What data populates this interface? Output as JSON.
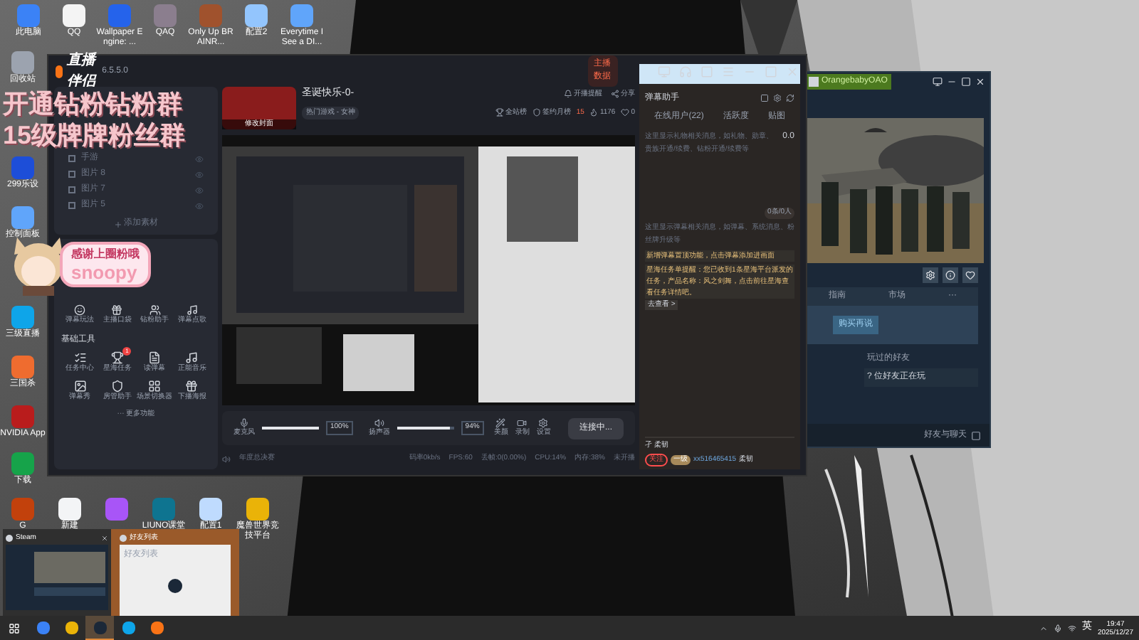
{
  "desktop": {
    "top_icons": [
      "此电脑",
      "QQ",
      "Wallpaper Engine: ...",
      "QAQ",
      "Only Up BRAINR...",
      "配置2",
      "Everytime I See a DI..."
    ],
    "left_icons": [
      "回收站",
      "299乐设",
      "控制面板",
      "三级直播",
      "三国杀",
      "NVIDIA App",
      "下载"
    ],
    "bottom_icons": [
      {
        "kind": "labeled",
        "label": "G"
      },
      {
        "kind": "labeled",
        "label": "新建"
      },
      {
        "kind": "plain"
      },
      {
        "kind": "labeled",
        "label": "LIUNO课堂"
      },
      {
        "kind": "labeled",
        "label": "配置1"
      },
      {
        "kind": "labeled",
        "label": "魔兽世界竞技平台"
      }
    ],
    "overlay_lines": [
      "开通钻粉钻粉群",
      "15级牌牌粉丝群"
    ],
    "sticker": {
      "caption": "感谢上圈粉哦",
      "name": "snoopy"
    }
  },
  "live_app": {
    "title": "直播伴侣",
    "version": "6.5.5.0",
    "data_button": "主播数据",
    "room": {
      "name": "圣诞快乐-0-",
      "category": "热门游戏 - 女神",
      "cover_button": "修改封面",
      "remind": "开播提醒",
      "share": "分享",
      "rank_all": "全站榜",
      "rank_month": "签约月榜",
      "rank_value": "15",
      "likes": "1176",
      "hearts": "0"
    },
    "scenes": [
      {
        "name": "手游",
        "checked": false
      },
      {
        "name": "图片 8",
        "checked": false
      },
      {
        "name": "图片 7",
        "checked": false
      },
      {
        "name": "图片 5",
        "checked": false
      }
    ],
    "add_source": "添加素材",
    "tools_top": [
      "弹幕玩法",
      "主播口袋",
      "钻粉助手",
      "弹幕点歌"
    ],
    "basic_title": "基础工具",
    "tools": [
      {
        "label": "任务中心"
      },
      {
        "label": "星海任务",
        "badge": "1"
      },
      {
        "label": "读弹幕"
      },
      {
        "label": "正能音乐"
      },
      {
        "label": "弹幕秀"
      },
      {
        "label": "房管助手"
      },
      {
        "label": "场景切换器"
      },
      {
        "label": "下播海报"
      }
    ],
    "more": "··· 更多功能",
    "controls": {
      "mic": {
        "label": "麦克风",
        "level": 1.0,
        "value": "100%"
      },
      "speaker": {
        "label": "扬声器",
        "level": 0.94,
        "value": "94%"
      },
      "beauty": "美颜",
      "record": "录制",
      "settings": "设置",
      "connect": "连接中..."
    },
    "status": {
      "notice": "年度总决赛",
      "items": [
        "码率0kb/s",
        "FPS:60",
        "丢帧:0(0.00%)",
        "CPU:14%",
        "内存:38%",
        "未开播"
      ]
    },
    "chat": {
      "title": "弹幕助手",
      "tabs": [
        {
          "label": "在线用户(22)",
          "selected": false
        },
        {
          "label": "活跃度",
          "selected": false
        },
        {
          "label": "贴图",
          "selected": false
        }
      ],
      "gift_hint": "这里显示礼物相关消息，如礼物、勋章、贵族开通/续费、钻粉开通/续费等",
      "gift_total": "0.0",
      "count": "0条/0人",
      "danmu_hint": "这里显示弹幕相关消息，如弹幕、系统消息、粉丝牌升级等",
      "notices": [
        "新增弹幕置顶功能，点击弹幕添加进画面",
        "星海任务单提醒：您已收到1条星海平台派发的任务，产品名称：风之剑舞，点击前往星海查看任务详情吧。"
      ],
      "notice_link": "去查看 >",
      "user_line": "孑 柔韧",
      "tag_follow": "关注",
      "tag_level": "一级",
      "user_id": "xx516465415",
      "user_name": "柔韧"
    }
  },
  "steam": {
    "user": "OrangebabyOAO",
    "buy": "购买再说",
    "tabs": [
      "指南",
      "市场",
      "···"
    ],
    "friends_title": "玩过的好友",
    "friends_playing": "? 位好友正在玩",
    "chat": "好友与聊天"
  },
  "thumbnails": [
    {
      "title": "Steam"
    },
    {
      "title": "好友列表",
      "body": "好友列表"
    }
  ],
  "taskbar": {
    "language": "英",
    "time": "19:47",
    "date": "2025/12/27",
    "apps": [
      {
        "selected": false
      },
      {
        "selected": false
      },
      {
        "selected": true
      },
      {
        "selected": false
      },
      {
        "selected": false
      }
    ]
  }
}
